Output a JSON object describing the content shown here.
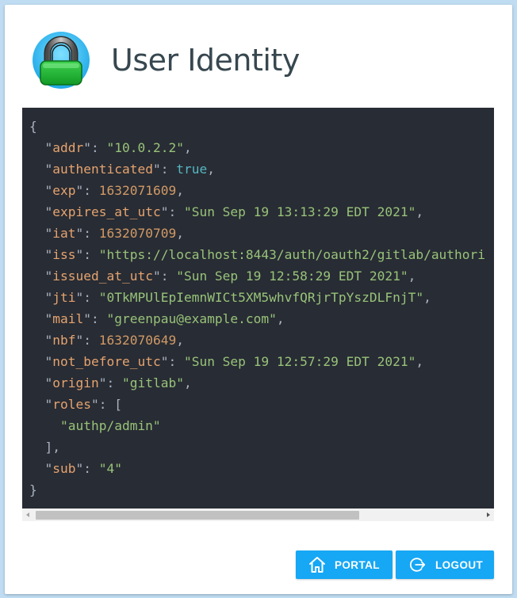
{
  "header": {
    "title": "User Identity",
    "logo_icon": "padlock-icon"
  },
  "identity_json": [
    {
      "key": "addr",
      "value": "\"10.0.2.2\"",
      "type": "string"
    },
    {
      "key": "authenticated",
      "value": "true",
      "type": "bool"
    },
    {
      "key": "exp",
      "value": "1632071609",
      "type": "number"
    },
    {
      "key": "expires_at_utc",
      "value": "\"Sun Sep 19 13:13:29 EDT 2021\"",
      "type": "string"
    },
    {
      "key": "iat",
      "value": "1632070709",
      "type": "number"
    },
    {
      "key": "iss",
      "value": "\"https://localhost:8443/auth/oauth2/gitlab/authori",
      "type": "string"
    },
    {
      "key": "issued_at_utc",
      "value": "\"Sun Sep 19 12:58:29 EDT 2021\"",
      "type": "string"
    },
    {
      "key": "jti",
      "value": "\"0TkMPUlEpIemnWICt5XM5whvfQRjrTpYszDLFnjT\"",
      "type": "string"
    },
    {
      "key": "mail",
      "value": "\"greenpau@example.com\"",
      "type": "string"
    },
    {
      "key": "nbf",
      "value": "1632070649",
      "type": "number"
    },
    {
      "key": "not_before_utc",
      "value": "\"Sun Sep 19 12:57:29 EDT 2021\"",
      "type": "string"
    },
    {
      "key": "origin",
      "value": "\"gitlab\"",
      "type": "string"
    }
  ],
  "roles": {
    "key": "roles",
    "items": [
      "\"authp/admin\""
    ]
  },
  "sub": {
    "key": "sub",
    "value": "\"4\""
  },
  "buttons": {
    "portal_label": "PORTAL",
    "logout_label": "LOGOUT"
  },
  "colors": {
    "accent": "#16a7f5",
    "code_bg": "#282c34",
    "title": "#37474f"
  }
}
